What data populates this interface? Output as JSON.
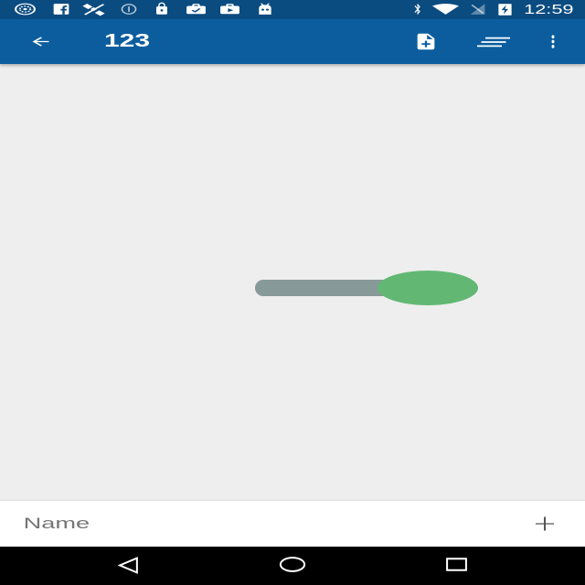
{
  "status_bar": {
    "notification_icons": [
      "sync-pattern-icon",
      "facebook-icon",
      "satellite-off-icon",
      "info-circle-icon",
      "lock-icon",
      "briefcase-check-icon",
      "briefcase-play-icon",
      "android-icon"
    ],
    "system_icons": [
      "bluetooth-icon",
      "wifi-icon",
      "no-signal-icon",
      "battery-charging-icon"
    ],
    "time": "12:59"
  },
  "app_bar": {
    "back_icon": "arrow-back-icon",
    "title": "123",
    "actions": [
      "add-document-icon",
      "sort-icon",
      "overflow-menu-icon"
    ]
  },
  "main": {
    "switch": {
      "checked": true
    }
  },
  "bottom_bar": {
    "name_input": {
      "placeholder": "Name"
    },
    "add_icon": "plus-icon"
  },
  "nav_bar": {
    "buttons": [
      "back-triangle-icon",
      "home-circle-icon",
      "recents-square-icon"
    ]
  },
  "colors": {
    "status_bar": "#0a4b80",
    "app_bar": "#0b5d9e",
    "on_primary": "#ffffff",
    "background": "#eeeeee",
    "switch_track": "#889999",
    "switch_thumb": "#62b873",
    "bottom_bar": "#ffffff",
    "placeholder": "#757575",
    "bottom_icon": "#555555",
    "nav_bar": "#000000"
  }
}
